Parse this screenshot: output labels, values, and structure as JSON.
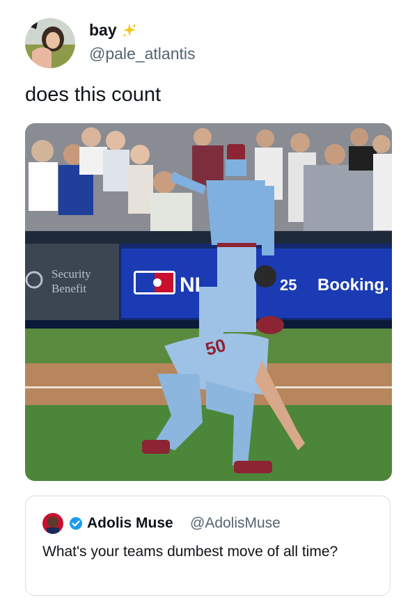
{
  "tweet": {
    "author_name": "bay",
    "author_handle": "@pale_atlantis",
    "text": "does this count",
    "emoji_icon": "sparkles-icon"
  },
  "media": {
    "signs": {
      "security_line1": "Security",
      "security_line2": "Benefit",
      "mlb_fragment": "NI",
      "series_fragment": "25",
      "booking": "Booking."
    },
    "jersey_number": "50"
  },
  "quoted_tweet": {
    "author_name": "Adolis Muse",
    "author_handle": "@AdolisMuse",
    "text": "What's your teams dumbest move of all time?",
    "verified_icon": "verified-badge-icon"
  },
  "colors": {
    "text_primary": "#0f1419",
    "text_secondary": "#536471",
    "border": "#d9dde1",
    "sparkle": "#f5c518",
    "verified": "#1d9bf0"
  }
}
